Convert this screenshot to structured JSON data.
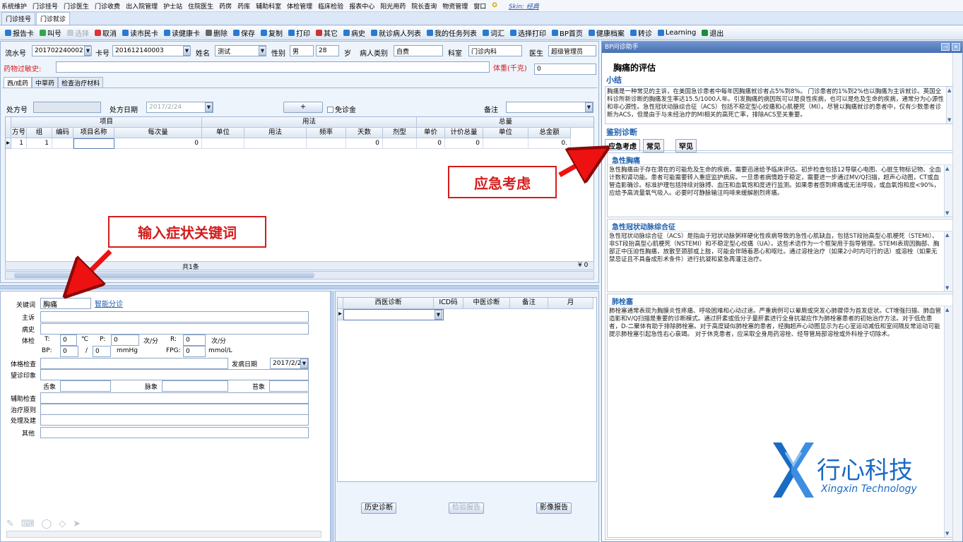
{
  "menu": [
    "系统维护",
    "门诊挂号",
    "门诊医生",
    "门诊收费",
    "出入院管理",
    "护士站",
    "住院医生",
    "药房",
    "药库",
    "辅助科室",
    "体检管理",
    "临床检验",
    "报表中心",
    "阳光用药",
    "院长查询",
    "物资管理",
    "窗口"
  ],
  "skin": "Skin: 经典",
  "tabs": [
    "门诊挂号",
    "门诊就诊"
  ],
  "toolbar": [
    "报告卡",
    "叫号",
    "取消",
    "读市民卡",
    "读健康卡",
    "删除",
    "保存",
    "复制",
    "打印",
    "其它",
    "病史",
    "就诊病人列表",
    "我的任务列表",
    "词汇",
    "选择打印",
    "BP首页",
    "健康档案",
    "转诊",
    "Learning",
    "退出"
  ],
  "toolbar_disabled": "选择",
  "patient": {
    "serial_label": "流水号",
    "serial": "201702240002",
    "card_label": "卡号",
    "card": "201612140003",
    "name_label": "姓名",
    "name": "测试",
    "sex_label": "性别",
    "sex": "男",
    "age": "28",
    "age_unit": "岁",
    "type_label": "病人类别",
    "type": "自费",
    "dept_label": "科室",
    "dept": "门诊内科",
    "doctor_label": "医生",
    "doctor": "超级管理员"
  },
  "allergy_label": "药物过敏史:",
  "weight_label": "体重(千克)",
  "weight": "0",
  "rx_tabs": [
    "西/成药",
    "中草药",
    "检查治疗材料"
  ],
  "rx": {
    "no_label": "处方号",
    "date_label": "处方日期",
    "date": "2017/2/24",
    "add": "+",
    "exempt": "免诊金",
    "remark_label": "备注"
  },
  "grid": {
    "group_project": "项目",
    "group_usage": "用法",
    "group_total": "总量",
    "cols": [
      "方号",
      "组",
      "编码",
      "项目名称",
      "每次量",
      "单位",
      "用法",
      "频率",
      "天数",
      "剂型",
      "单价",
      "计价总量",
      "单位",
      "总金额"
    ],
    "row": [
      "1",
      "1",
      "",
      "",
      "0",
      "",
      "",
      "",
      "0",
      "",
      "0",
      "0",
      "",
      "0."
    ]
  },
  "footer": {
    "count": "共1条",
    "amount": "¥ 0"
  },
  "clinic": {
    "keyword_label": "关键词",
    "keyword": "胸痛",
    "smart_link": "智能分诊",
    "complaint": "主诉",
    "history": "病史",
    "vitals": "体检",
    "t_label": "T:",
    "t": "0",
    "t_unit": "℃",
    "p_label": "P:",
    "p": "0",
    "p_unit": "次/分",
    "r_label": "R:",
    "r": "0",
    "r_unit": "次/分",
    "bp_label": "BP:",
    "bp1": "0",
    "bp_sep": "/",
    "bp2": "0",
    "bp_unit": "mmHg",
    "fpg_label": "FPG:",
    "fpg": "0",
    "fpg_unit": "mmol/L",
    "exam": "体格检查",
    "onset_label": "发病日期",
    "onset": "2017/2/2",
    "inspection": "望诊印象",
    "tongue": "舌象",
    "pulse": "脉象",
    "coating": "苔象",
    "aux": "辅助检查",
    "principle": "治疗原则",
    "disposal": "处理及建",
    "other": "其他"
  },
  "dx": {
    "cols": [
      "西医诊断",
      "ICD码",
      "中医诊断",
      "备注",
      "月"
    ],
    "history_btn": "历史诊断",
    "lab_btn": "检验报告",
    "image_btn": "影像报告"
  },
  "assist": {
    "title": "BP问诊助手",
    "heading": "胸痛的评估",
    "summary_h": "小结",
    "summary": "胸痛是一种常见的主诉，在美国急诊患者中每年因胸痛就诊者占5%到8%。 门诊患者的1%到2%也以胸痛为主诉就诊。英国全科诊所新诊断的胸痛发生率达15.5/1000人年。引发胸痛的病因既可以是良性疾病，也可以是危及生命的疾病，通常分为心源性和非心源性。急性冠状动脉综合征（ACS）包括不稳定型心绞痛和心肌梗死（MI）。尽管以胸痛就诊的患者中，仅有少数患者诊断为ACS，但是由于与未经治疗的MI相关的高死亡率，排除ACS至关重要。",
    "dd_h": "鉴别诊断",
    "dd_tabs": [
      "应急考虑",
      "常见",
      "罕见"
    ],
    "sections": [
      {
        "title": "急性胸痛",
        "text": "急性胸痛由于存在潜在的可能危及生命的疾病，需要迅速给予临床评估。初步检查包括12导联心电图、心脏生物标记物、全血计数和肾功能。患者可能需要转入重症监护病房。一旦患者病情趋于稳定，需要进一步通过MV/Q扫描，超声心动图，CT或血管造影确诊。标准护理包括持续对脉搏、血压和血氧饱和度进行监测。如果患者感到疼痛或无法呼吸，或血氧饱和度<90%，应给予高流量氧气吸入。必要时可静脉输注吗啡来缓解剧烈疼痛。"
      },
      {
        "title": "急性冠状动脉综合征",
        "text": "急性冠状动脉综合征（ACS）是指由于冠状动脉粥样硬化性疾病导致的急性心肌缺血，包括ST段抬高型心肌梗死（STEMI）、非ST段抬高型心肌梗死（NSTEMI）和不稳定型心绞痛（UA）。这些术语作为一个框架用于指导管理。STEMI表现因胸部、胸部正中压迫性胸痛，放散至颈部或上肢，可能会伴随着恶心和呕吐。通过溶栓治疗（如果2小时内可行的话）或溶栓（如果无禁忌证且不具备成形术条件）进行抗凝和紧急再灌注治疗。"
      },
      {
        "title": "肺栓塞",
        "text": "肺栓塞通常表现为胸膜炎性疼痛、呼吸困难和心动过速。严重病例可以晕厥或突发心肺骤停为首发症状。CT增强扫描、肺血管造影和V/Q扫描是重要的诊断模式。通过肝素或低分子量肝素进行全身抗凝应作为肺栓塞患者的初始治疗方法。对于低危患者，D-二聚体有助于排除肺栓塞。对于高度疑似肺栓塞的患者，经胸超声心动图显示为右心室运动减低和室间隔反常运动可能提示肺栓塞引起急性右心衰竭。 对于休克患者，应采取全身用药溶栓、经导管局部溶栓或外科栓子切除术。"
      }
    ]
  },
  "callouts": {
    "keyword": "输入症状关键词",
    "emergency": "应急考虑"
  },
  "logo": {
    "cn": "行心科技",
    "en": "Xingxin Technology"
  },
  "colors": {
    "accent": "#1e5fae",
    "callout": "#d41c1c",
    "logo": "#1a6bc4"
  }
}
